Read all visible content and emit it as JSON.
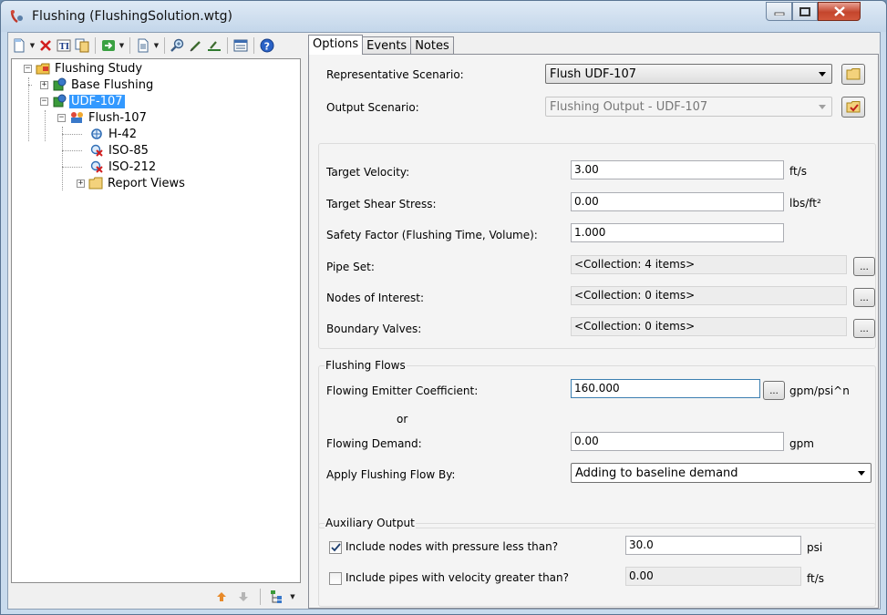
{
  "window": {
    "title": "Flushing (FlushingSolution.wtg)"
  },
  "toolbar": {
    "icons": [
      "new-icon",
      "delete-icon",
      "rename-icon",
      "copy-icon",
      "compute-icon",
      "report-icon",
      "zoom-icon",
      "edit-icon",
      "results-icon",
      "properties-icon",
      "help-icon"
    ]
  },
  "tree": {
    "root": "Flushing Study",
    "items": [
      {
        "label": "Base Flushing"
      },
      {
        "label": "UDF-107"
      },
      {
        "label": "Flush-107"
      },
      {
        "label": "H-42"
      },
      {
        "label": "ISO-85"
      },
      {
        "label": "ISO-212"
      },
      {
        "label": "Report Views"
      }
    ]
  },
  "tabs": [
    {
      "label": "Options",
      "active": true
    },
    {
      "label": "Events",
      "active": false
    },
    {
      "label": "Notes",
      "active": false
    }
  ],
  "options": {
    "representative_scenario": {
      "label": "Representative Scenario:",
      "value": "Flush UDF-107"
    },
    "output_scenario": {
      "label": "Output Scenario:",
      "value": "Flushing Output - UDF-107"
    },
    "target_velocity": {
      "label": "Target Velocity:",
      "value": "3.00",
      "unit": "ft/s"
    },
    "target_shear": {
      "label": "Target Shear Stress:",
      "value": "0.00",
      "unit": "lbs/ft²"
    },
    "safety_factor": {
      "label": "Safety Factor (Flushing Time, Volume):",
      "value": "1.000"
    },
    "pipe_set": {
      "label": "Pipe Set:",
      "value": "<Collection: 4 items>"
    },
    "nodes_of_interest": {
      "label": "Nodes of Interest:",
      "value": "<Collection: 0 items>"
    },
    "boundary_valves": {
      "label": "Boundary Valves:",
      "value": "<Collection: 0 items>"
    }
  },
  "flushing_flows": {
    "title": "Flushing Flows",
    "emitter": {
      "label": "Flowing Emitter Coefficient:",
      "value": "160.000",
      "unit": "gpm/psi^n"
    },
    "or_label": "or",
    "demand": {
      "label": "Flowing Demand:",
      "value": "0.00",
      "unit": "gpm"
    },
    "apply_by": {
      "label": "Apply Flushing Flow By:",
      "value": "Adding to baseline demand"
    }
  },
  "auxiliary_output": {
    "title": "Auxiliary Output",
    "pressure": {
      "label": "Include nodes with pressure less than?",
      "checked": true,
      "value": "30.0",
      "unit": "psi"
    },
    "velocity": {
      "label": "Include pipes with velocity greater than?",
      "checked": false,
      "value": "0.00",
      "unit": "ft/s"
    }
  },
  "colors": {
    "selection": "#3399ff",
    "accent_border": "#3c7fb1"
  }
}
